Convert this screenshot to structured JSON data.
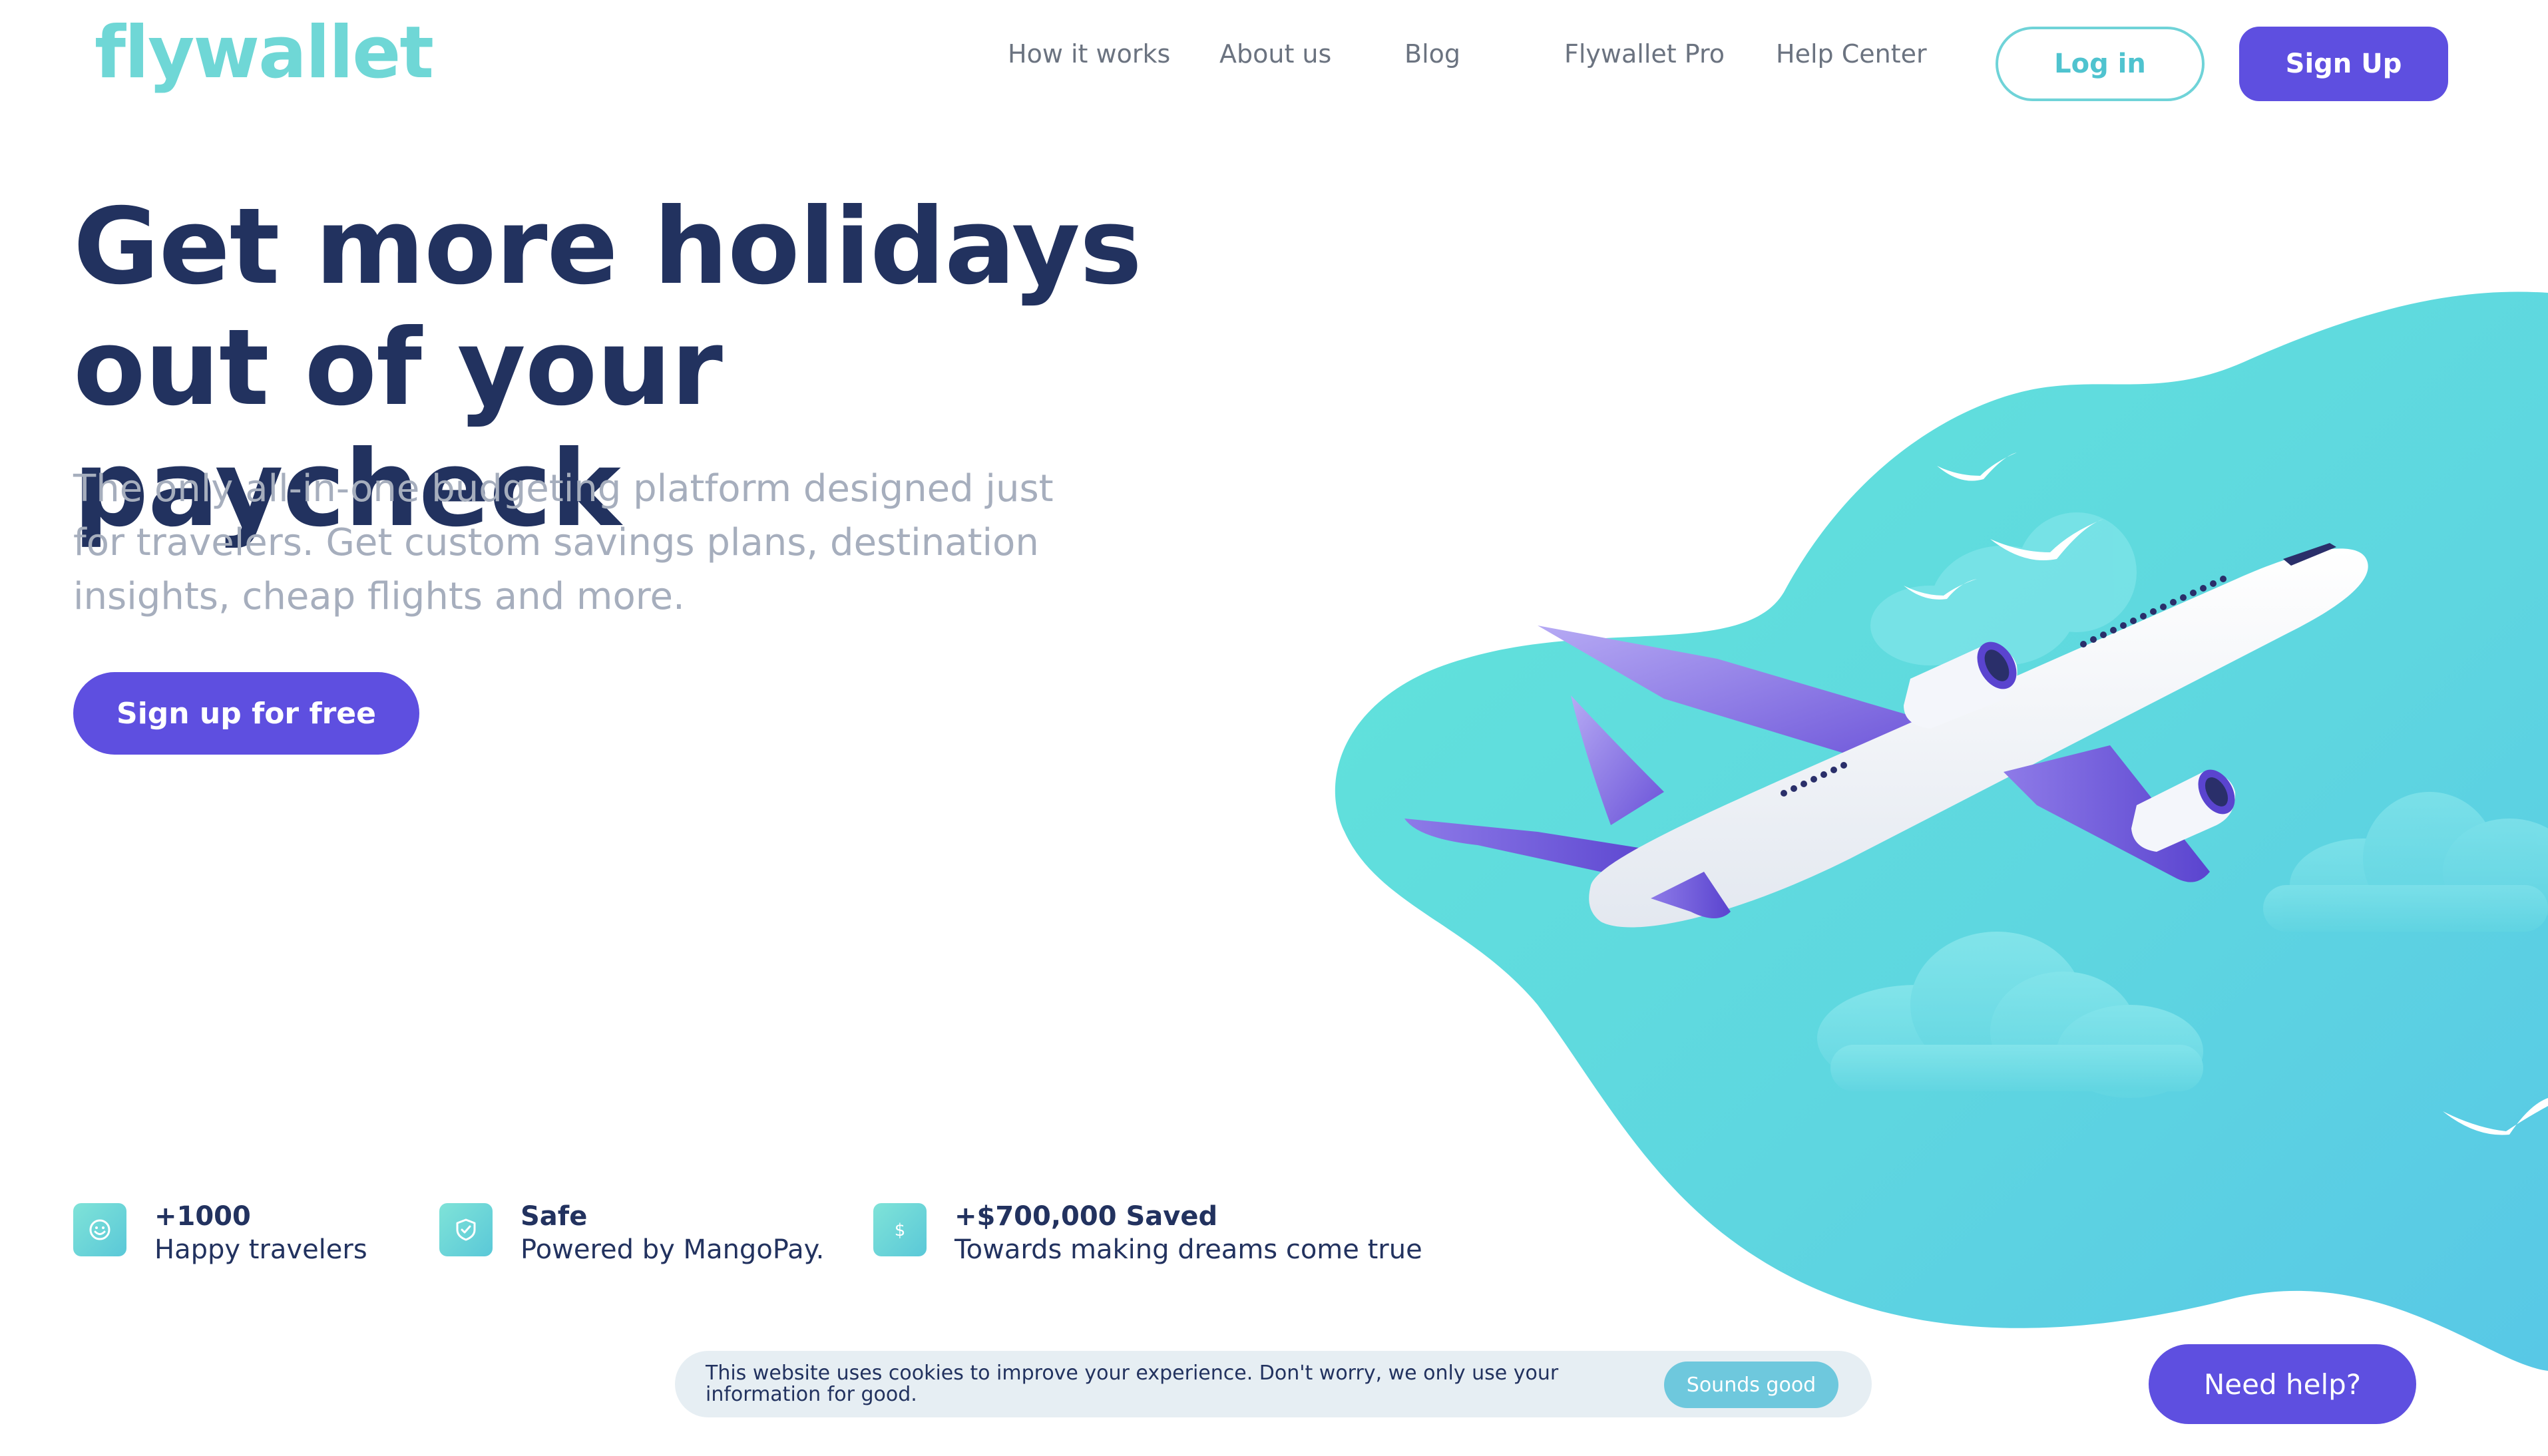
{
  "header": {
    "logo": "flywallet",
    "nav": [
      "How it works",
      "About us",
      "Blog",
      "Flywallet Pro",
      "Help Center"
    ],
    "login_label": "Log in",
    "signup_label": "Sign Up"
  },
  "hero": {
    "title_line1": "Get more holidays",
    "title_line2": "out of your paycheck",
    "subtitle_line1": "The only all-in-one budgeting platform designed just",
    "subtitle_line2": "for travelers. Get custom savings plans, destination",
    "subtitle_line3": "insights, cheap flights and more.",
    "cta_label": "Sign up for free"
  },
  "stats": [
    {
      "icon": "smiley-icon",
      "title": "+1000",
      "desc": "Happy travelers"
    },
    {
      "icon": "shield-icon",
      "title": "Safe",
      "desc": "Powered by MangoPay."
    },
    {
      "icon": "dollar-icon",
      "title": "+$700,000 Saved",
      "desc": "Towards making dreams come true"
    }
  ],
  "cookie": {
    "text": "This website uses cookies to improve your experience. Don't worry, we only use your information for good.",
    "button": "Sounds good"
  },
  "help": {
    "label": "Need help?"
  },
  "colors": {
    "primary": "#5e4fe0",
    "accent": "#6fd7d6",
    "heading": "#22325f",
    "muted": "#a6aebd"
  }
}
